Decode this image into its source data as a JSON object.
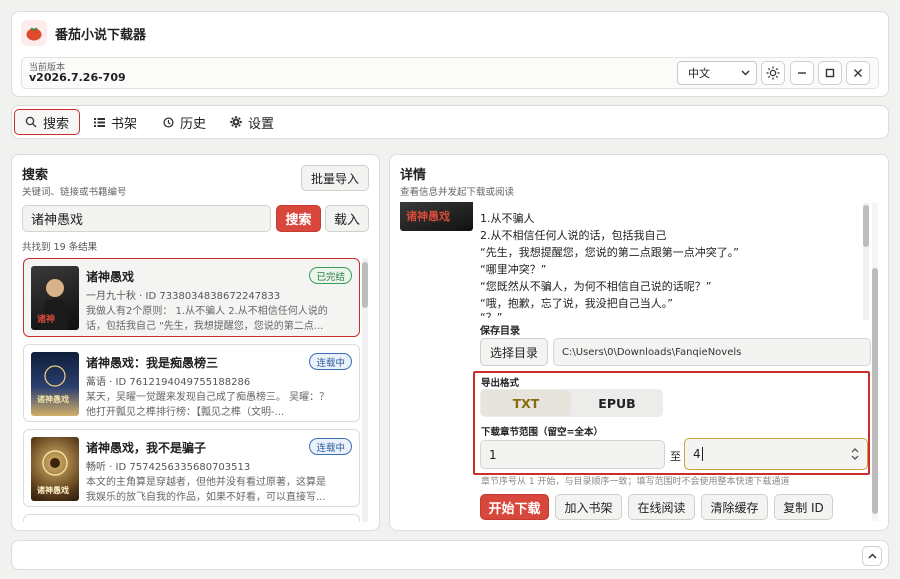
{
  "app": {
    "title": "番茄小说下载器",
    "version_label": "当前版本",
    "version": "v2026.7.26-709",
    "language": "中文"
  },
  "tabs": [
    {
      "label": "搜索",
      "icon": "search-icon",
      "active": true
    },
    {
      "label": "书架",
      "icon": "list-icon",
      "active": false
    },
    {
      "label": "历史",
      "icon": "history-icon",
      "active": false
    },
    {
      "label": "设置",
      "icon": "gear-icon",
      "active": false
    }
  ],
  "search": {
    "title": "搜索",
    "subtitle": "关键词、链接或书籍编号",
    "batch_import": "批量导入",
    "query": "诸神愚戏",
    "search_button": "搜索",
    "load_button": "载入",
    "result_count": "共找到 19 条结果",
    "results": [
      {
        "title": "诸神愚戏",
        "meta": "一月九十秋 · ID 7338034838672247833",
        "desc": "我做人有2个原则： 1.从不骗人 2.从不相信任何人说的话，包括我自己 \"先生，我想提醒您，您说的第二点...",
        "status": "已完结"
      },
      {
        "title": "诸神愚戏：我是痴愚榜三",
        "meta": "蒿语 · ID 7612194049755188286",
        "desc": "某天，吴曜一觉醒来发现自己成了痴愚榜三。 吴曜：？ 他打开瓢见之榫排行榜：【瓢见之榫（文明-...",
        "status": "连载中"
      },
      {
        "title": "诸神愚戏，我不是骗子",
        "meta": "畅听 · ID 7574256335680703513",
        "desc": "本文的主角算是穿越者，但他并没有看过原著，这算是我娱乐的放飞自我的作品，如果不好看，可以直接写...",
        "status": "连载中"
      }
    ]
  },
  "detail": {
    "title": "详情",
    "subtitle": "查看信息并发起下载或阅读",
    "preview_lines": [
      "1.从不骗人",
      "2.从不相信任何人说的话，包括我自己",
      "“先生，我想提醒您，您说的第二点跟第一点冲突了。”",
      "“哪里冲突？”",
      "“您既然从不骗人，为何不相信自己说的话呢？”",
      "“哦，抱歉，忘了说，我没把自己当人。”",
      "“？”"
    ],
    "save_dir_label": "保存目录",
    "choose_dir_button": "选择目录",
    "save_dir_path": "C:\\Users\\0\\Downloads\\FanqieNovels",
    "format_label": "导出格式",
    "formats": [
      "TXT",
      "EPUB"
    ],
    "selected_format": "TXT",
    "range_label": "下载章节范围（留空=全本）",
    "range_from": "1",
    "range_to_label": "至",
    "range_to": "4",
    "hint": "章节序号从 1 开始，与目录顺序一致；填写范围时不会使用整本快速下载通道",
    "actions": {
      "start": "开始下载",
      "shelf": "加入书架",
      "read": "在线阅读",
      "clear": "清除缓存",
      "copy_id": "复制 ID"
    }
  },
  "colors": {
    "accent_red": "#d8473c",
    "highlight_border": "#c9302c",
    "done_green": "#2f7d44",
    "ongoing_blue": "#2c5d9e",
    "selected_format_text": "#8a6a10"
  }
}
